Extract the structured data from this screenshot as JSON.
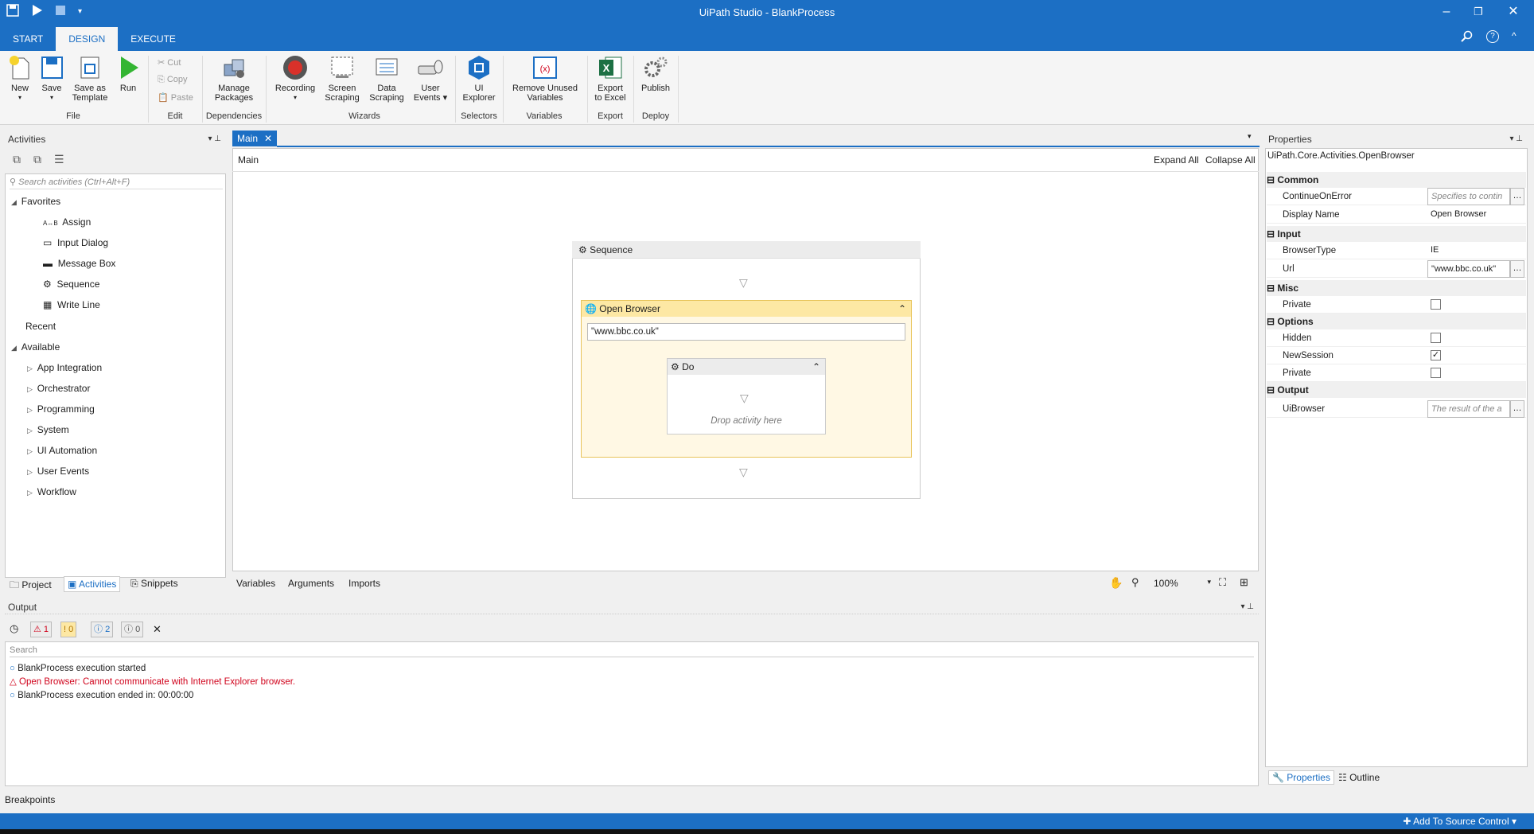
{
  "window": {
    "title": "UiPath Studio - BlankProcess"
  },
  "tabs": [
    "START",
    "DESIGN",
    "EXECUTE"
  ],
  "ribbon": {
    "new": "New",
    "save": "Save",
    "save_as_template_1": "Save as",
    "save_as_template_2": "Template",
    "run": "Run",
    "cut": "Cut",
    "copy": "Copy",
    "paste": "Paste",
    "manage_packages_1": "Manage",
    "manage_packages_2": "Packages",
    "recording": "Recording",
    "screen_scraping_1": "Screen",
    "screen_scraping_2": "Scraping",
    "data_scraping_1": "Data",
    "data_scraping_2": "Scraping",
    "user_events_1": "User",
    "user_events_2": "Events",
    "ui_explorer_1": "UI",
    "ui_explorer_2": "Explorer",
    "remove_unused_1": "Remove Unused",
    "remove_unused_2": "Variables",
    "export_excel_1": "Export",
    "export_excel_2": "to Excel",
    "publish": "Publish",
    "groups": {
      "file": "File",
      "edit": "Edit",
      "dependencies": "Dependencies",
      "wizards": "Wizards",
      "selectors": "Selectors",
      "variables": "Variables",
      "export": "Export",
      "deploy": "Deploy"
    }
  },
  "activities": {
    "title": "Activities",
    "search_placeholder": "Search activities (Ctrl+Alt+F)",
    "favorites": "Favorites",
    "favorite_items": [
      "Assign",
      "Input Dialog",
      "Message Box",
      "Sequence",
      "Write Line"
    ],
    "recent": "Recent",
    "available": "Available",
    "available_items": [
      "App Integration",
      "Orchestrator",
      "Programming",
      "System",
      "UI Automation",
      "User Events",
      "Workflow"
    ],
    "bottom_tabs": [
      "Project",
      "Activities",
      "Snippets"
    ]
  },
  "designer": {
    "doc_tab": "Main",
    "breadcrumb": "Main",
    "expand_all": "Expand All",
    "collapse_all": "Collapse All",
    "sequence_title": "Sequence",
    "open_browser_title": "Open Browser",
    "url_value": "\"www.bbc.co.uk\"",
    "do_title": "Do",
    "drop_hint": "Drop activity here",
    "bottom_tabs": [
      "Variables",
      "Arguments",
      "Imports"
    ],
    "zoom": "100%"
  },
  "properties": {
    "title": "Properties",
    "type_name": "UiPath.Core.Activities.OpenBrowser",
    "common": "Common",
    "continue_on_error": "ContinueOnError",
    "continue_on_error_placeholder": "Specifies to contin",
    "display_name": "Display Name",
    "display_name_value": "Open Browser",
    "input": "Input",
    "browser_type": "BrowserType",
    "browser_type_value": "IE",
    "url": "Url",
    "url_value": "\"www.bbc.co.uk\"",
    "misc": "Misc",
    "private": "Private",
    "options": "Options",
    "hidden": "Hidden",
    "new_session": "NewSession",
    "private2": "Private",
    "output": "Output",
    "ui_browser": "UiBrowser",
    "ui_browser_placeholder": "The result of the a",
    "checks": {
      "misc_private": false,
      "hidden": false,
      "new_session": true,
      "options_private": false
    },
    "bottom_tabs": [
      "Properties",
      "Outline"
    ]
  },
  "output": {
    "title": "Output",
    "counts": {
      "errors": "1",
      "warnings": "0",
      "info": "2",
      "trace": "0"
    },
    "search_placeholder": "Search",
    "lines": [
      "BlankProcess execution started",
      "Open Browser: Cannot communicate with Internet Explorer browser.",
      "BlankProcess execution ended in: 00:00:00"
    ]
  },
  "breakpoints": "Breakpoints",
  "status": {
    "source_control": "Add To Source Control"
  },
  "colors": {
    "accent": "#1c6fc4",
    "open_browser_header": "#fde8a4",
    "error": "#d0021b"
  }
}
